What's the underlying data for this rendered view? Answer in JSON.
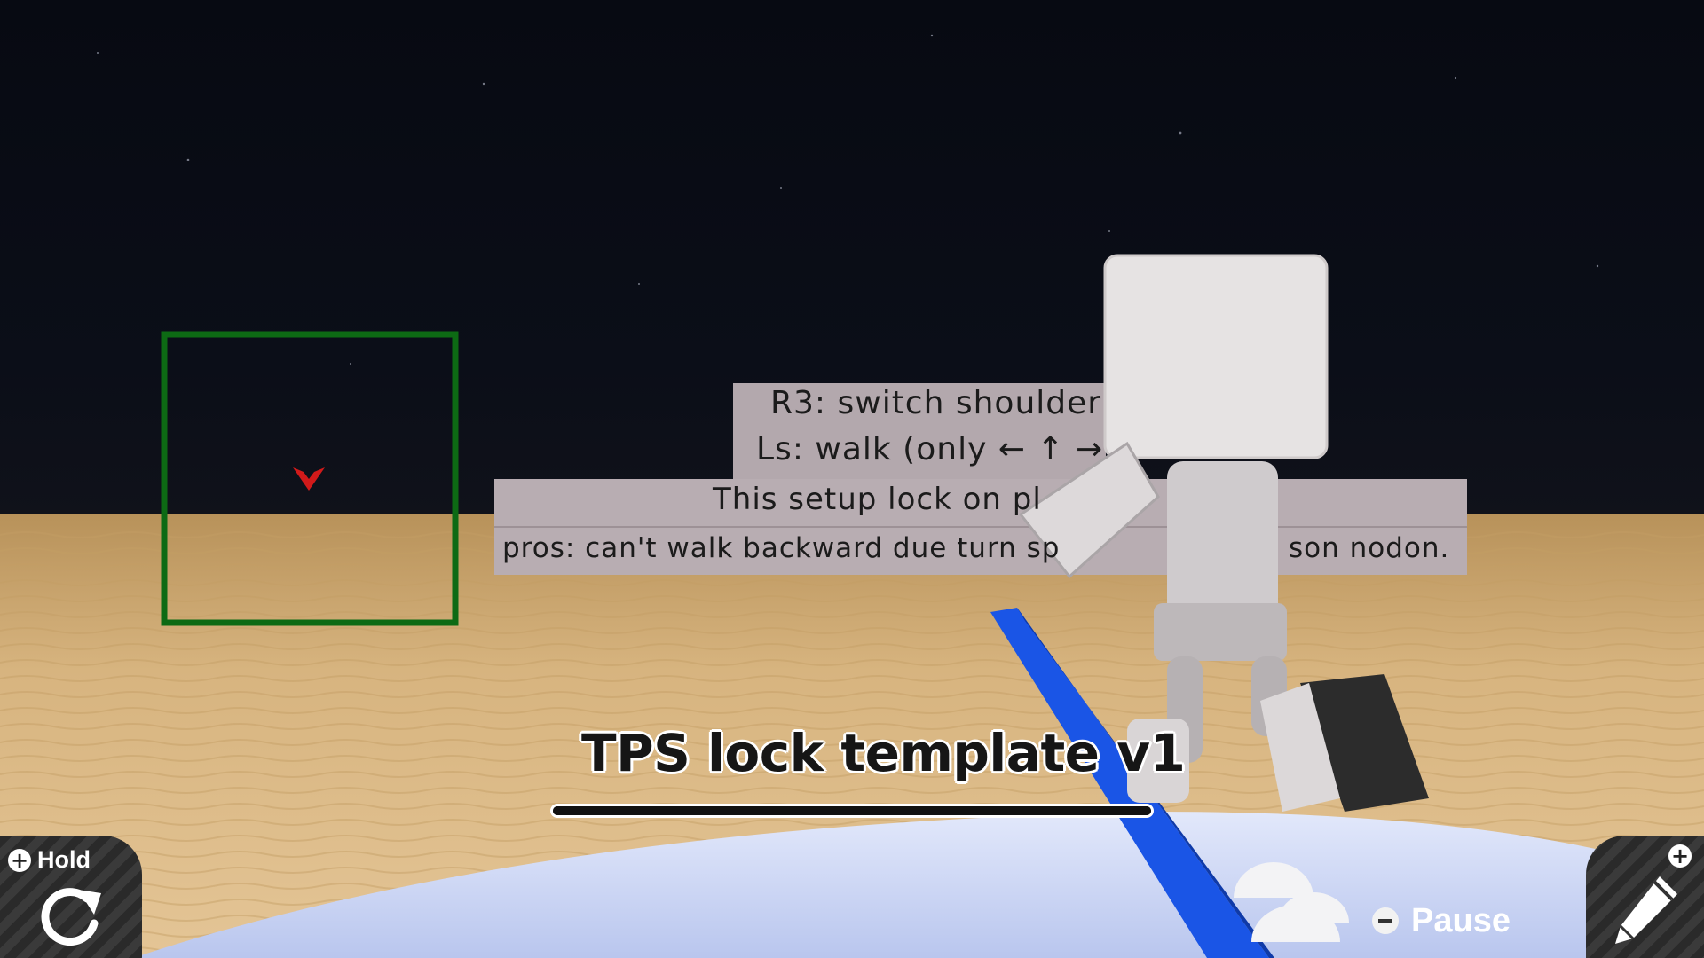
{
  "sign": {
    "line1": "R3: switch shoulder",
    "line2": "Ls: walk (only ← ↑ →",
    "line3": "This setup lock on pl",
    "line4": "pros: can't walk backward due turn sp",
    "line4_tail": "son nodon."
  },
  "title": "TPS lock template v1",
  "progress": 1.0,
  "controls": {
    "hold_label": "Hold",
    "pause_label": "Pause"
  },
  "icons": [
    "plus-icon",
    "reset-icon",
    "minus-icon",
    "pencil-icon",
    "plus-icon"
  ],
  "colors": {
    "sky": "#05070d",
    "sand": "#d7b47f",
    "sign": "#b3a8ad",
    "beam": "#1a55e6",
    "target_frame": "#0d6a14",
    "crosshair": "#d21a1a",
    "floor": "#c9d4f2"
  }
}
